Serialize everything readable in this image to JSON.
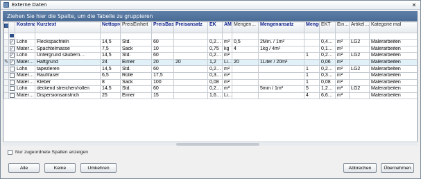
{
  "window": {
    "title": "Externe Daten",
    "close_glyph": "✕"
  },
  "group_panel": {
    "text": "Ziehen Sie hier die Spalte, um die Tabelle zu gruppieren"
  },
  "columns": [
    "Kostenart",
    "Kurztext",
    "Nettopreis",
    "PreisEinheit",
    "PreisBasis",
    "Preisansatz",
    "EK",
    "AME",
    "Mengen…",
    "Mengenansatz",
    "Menge",
    "EKT",
    "Ein…",
    "Artikel…",
    "Kategorie mal"
  ],
  "rows": [
    {
      "checked": true,
      "selected": false,
      "editing": false,
      "cells": [
        "Lohn",
        "Fleckspachteln",
        "14,5",
        "Std.",
        "60",
        "",
        "0,2…",
        "m²",
        "0,5",
        "2Min. / 1m²",
        "",
        "0,4…",
        "m²",
        "LG2",
        "Malerarbeiten"
      ]
    },
    {
      "checked": true,
      "selected": false,
      "editing": false,
      "cells": [
        "Mater…",
        "Spachtelmasse",
        "7,5",
        "Sack",
        "10",
        "",
        "0,75",
        "kg",
        "4",
        "1kg / 4m²",
        "",
        "0,1…",
        "m²",
        "",
        "Malerarbeiten"
      ]
    },
    {
      "checked": true,
      "selected": false,
      "editing": false,
      "cells": [
        "Lohn",
        "Untergrund säubern…",
        "14,5",
        "Std.",
        "60",
        "",
        "0,2…",
        "m²",
        "",
        "",
        "1",
        "0,2…",
        "m²",
        "LG2",
        "Malerarbeiten"
      ]
    },
    {
      "checked": true,
      "selected": true,
      "editing": true,
      "cells": [
        "Mater…",
        "Haftgrund",
        "24",
        "Eimer",
        "20",
        "20",
        "1,2",
        "Li…",
        "20",
        "1Liter / 20m²",
        "",
        "0,06",
        "m²",
        "",
        "Malerarbeiten"
      ]
    },
    {
      "checked": false,
      "selected": false,
      "editing": false,
      "cells": [
        "Lohn",
        "tapezieren",
        "14,5",
        "Std.",
        "60",
        "",
        "0,2…",
        "m²",
        "",
        "",
        "1",
        "0,2…",
        "m²",
        "LG2",
        "Malerarbeiten"
      ]
    },
    {
      "checked": false,
      "selected": false,
      "editing": false,
      "cells": [
        "Mater…",
        "Rauhfaser",
        "6,5",
        "Rolle",
        "17,5",
        "",
        "0,3…",
        "m²",
        "",
        "",
        "1",
        "0,3…",
        "m²",
        "",
        "Malerarbeiten"
      ]
    },
    {
      "checked": false,
      "selected": false,
      "editing": false,
      "cells": [
        "Mater…",
        "Kleber",
        "8",
        "Sack",
        "100",
        "",
        "0,08",
        "m²",
        "",
        "",
        "1",
        "0,08",
        "m²",
        "",
        "Malerarbeiten"
      ]
    },
    {
      "checked": false,
      "selected": false,
      "editing": false,
      "cells": [
        "Lohn",
        "deckend streichen/rollen",
        "14,5",
        "Std.",
        "60",
        "",
        "0,2…",
        "m²",
        "",
        "5min / 1m²",
        "5",
        "1,2…",
        "m²",
        "LG2",
        "Malerarbeiten"
      ]
    },
    {
      "checked": false,
      "selected": false,
      "editing": false,
      "cells": [
        "Mater…",
        "Dispersionsanstrich",
        "25",
        "Eimer",
        "15",
        "",
        "1,6…",
        "Li…",
        "",
        "",
        "4",
        "6,6…",
        "m²",
        "",
        "Malerarbeiten"
      ]
    }
  ],
  "options": {
    "show_unassigned_label": "Nur zugeordnete Spalten anzeigen"
  },
  "buttons": {
    "all": "Alle",
    "none": "Keine",
    "invert": "Umkehren",
    "cancel": "Abbrechen",
    "apply": "Übernehmen"
  },
  "icons": {
    "edit_row_indicator": "pencil-icon",
    "group_by": "group-by-icon",
    "check": "checkmark-icon"
  }
}
